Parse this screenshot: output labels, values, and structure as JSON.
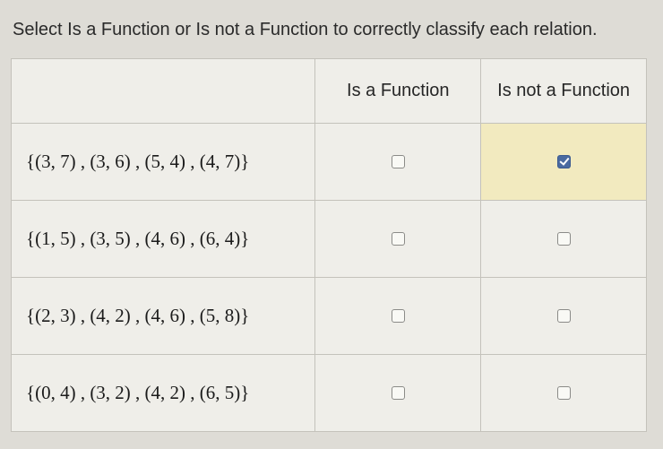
{
  "instruction": "Select Is a Function or Is not a Function to correctly classify each relation.",
  "headers": {
    "relation": "",
    "is_function": "Is a Function",
    "is_not_function": "Is not a Function"
  },
  "rows": [
    {
      "relation": "{(3, 7) , (3, 6) , (5, 4) , (4, 7)}",
      "is_function_checked": false,
      "is_not_function_checked": true
    },
    {
      "relation": "{(1, 5) , (3, 5) , (4, 6) , (6, 4)}",
      "is_function_checked": false,
      "is_not_function_checked": false
    },
    {
      "relation": "{(2, 3) , (4, 2) , (4, 6) , (5, 8)}",
      "is_function_checked": false,
      "is_not_function_checked": false
    },
    {
      "relation": "{(0, 4) , (3, 2) , (4, 2) , (6, 5)}",
      "is_function_checked": false,
      "is_not_function_checked": false
    }
  ]
}
